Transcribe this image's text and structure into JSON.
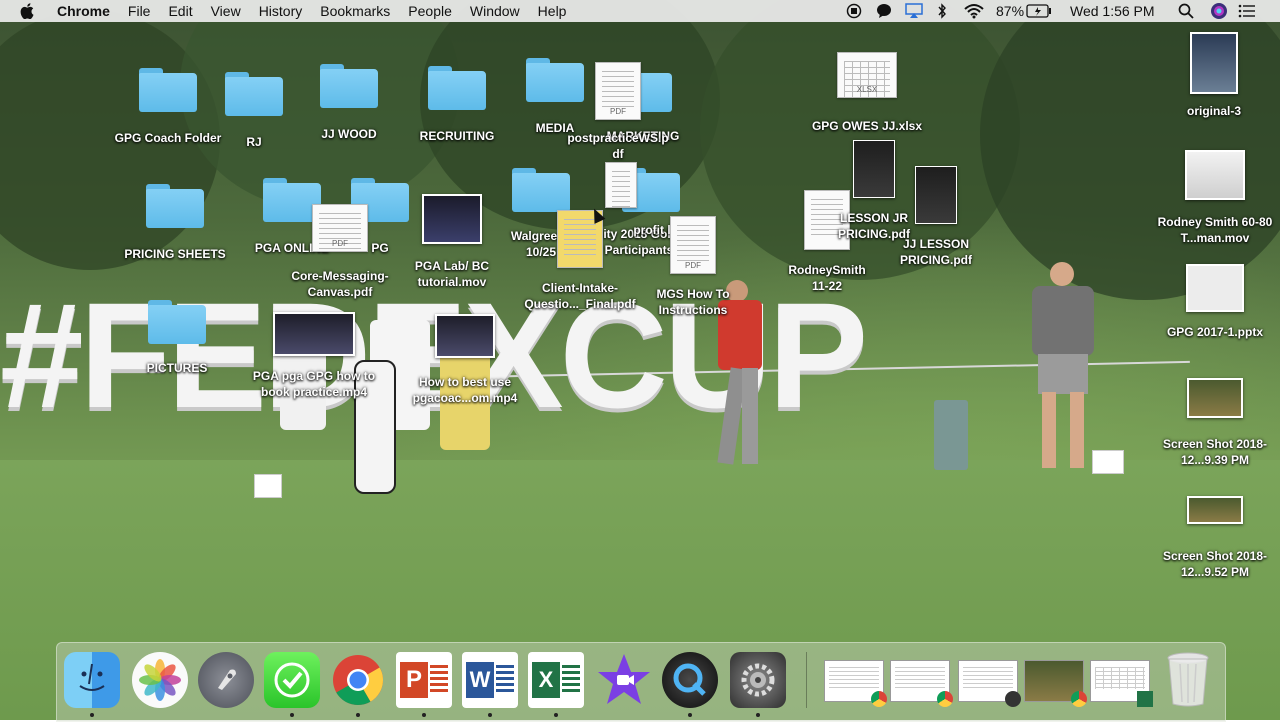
{
  "menubar": {
    "apple_icon": "apple-logo",
    "app_name": "Chrome",
    "menus": [
      "File",
      "Edit",
      "View",
      "History",
      "Bookmarks",
      "People",
      "Window",
      "Help"
    ],
    "battery": "87%",
    "clock": "Wed 1:56 PM"
  },
  "wallpaper": {
    "sign_text": "#FEDEXCUP"
  },
  "desktop_icons": {
    "gpg_coach_folder": "GPG Coach Folder",
    "rj": "RJ",
    "jj_wood": "JJ WOOD",
    "recruiting": "RECRUITING",
    "media": "MEDIA",
    "marketing": "MARKETING",
    "postpractice": "postpracticeWS.p df",
    "gpg_owes": "GPG OWES JJ.xlsx",
    "original3": "original-3",
    "pricing_sheets": "PRICING SHEETS",
    "pga_online": "PGA ONLINE",
    "pg": "PG",
    "core_messaging": "Core-Messaging- Canvas.pdf",
    "pga_lab": "PGA Lab/ BC tutorial.mov",
    "walgreens": "Walgreens 10/25",
    "port_city": "Port City 2018 Golf Clinic Participants",
    "profit_list": "profit list",
    "client_intake": "Client-Intake- Questio..._Final.pdf",
    "mgs_how_to": "MGS How To Instructions",
    "rodney_smith_11_22": "RodneySmith 11-22",
    "lesson_jr": "LESSON JR PRICING.pdf",
    "jj_lesson": "JJ LESSON PRICING.pdf",
    "rodney_smith_mov": "Rodney Smith 60-80 T...man.mov",
    "gpg_2017": "GPG 2017-1.pptx",
    "pictures": "PICTURES",
    "pga_pga_gpg": "PGA pga GPG how to book practice.mp4",
    "how_to_best_use": "How to best use pgacoac...om.mp4",
    "screenshot1": "Screen Shot 2018-12...9.39 PM",
    "screenshot2": "Screen Shot 2018-12...9.52 PM"
  },
  "file_tags": {
    "pdf": "PDF",
    "xlsx": "XLSX"
  },
  "dock": {
    "apps": [
      "Finder",
      "Photos",
      "Launchpad",
      "Messages",
      "Chrome",
      "PowerPoint",
      "Word",
      "Excel",
      "iMovie",
      "QuickTime Player",
      "System Preferences"
    ],
    "app_glyphs": {
      "powerpoint": "P",
      "word": "W",
      "excel": "X"
    },
    "trash": "Trash"
  },
  "colors": {
    "folder_blue": "#6cc3ef",
    "menubar_bg": "#ececec",
    "accent_red": "#d03a2e"
  }
}
